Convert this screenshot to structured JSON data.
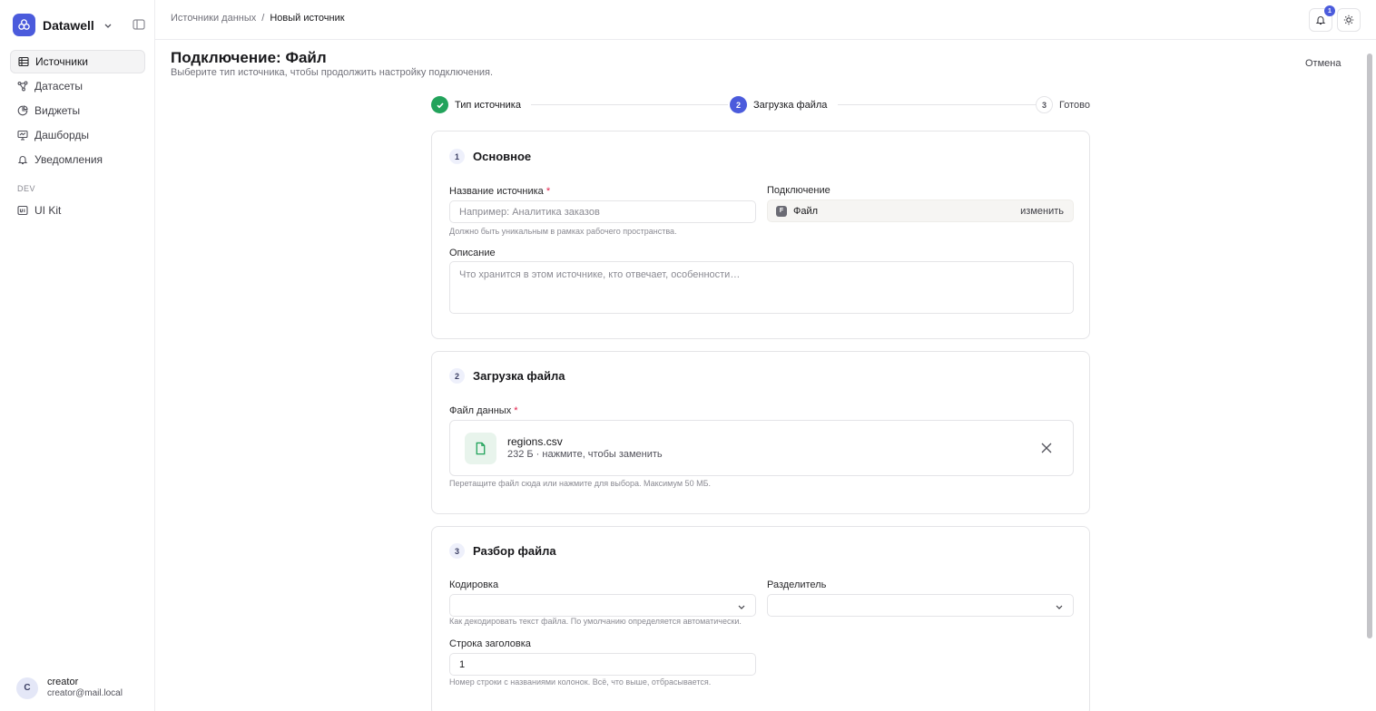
{
  "app": {
    "name": "Datawell"
  },
  "sidebar": {
    "items": [
      {
        "label": "Источники",
        "icon": "list-icon",
        "active": true
      },
      {
        "label": "Датасеты",
        "icon": "share-nodes-icon"
      },
      {
        "label": "Виджеты",
        "icon": "pie-chart-icon"
      },
      {
        "label": "Дашборды",
        "icon": "dashboard-icon"
      },
      {
        "label": "Уведомления",
        "icon": "bell-icon"
      }
    ],
    "section_dev": "DEV",
    "dev_items": [
      {
        "label": "UI Kit",
        "icon": "ui-kit-icon"
      }
    ]
  },
  "user": {
    "initial": "C",
    "name": "creator",
    "email": "creator@mail.local"
  },
  "topbar": {
    "breadcrumb_root": "Источники данных",
    "breadcrumb_sep": "/",
    "breadcrumb_current": "Новый источник",
    "notifications_count": "1"
  },
  "page": {
    "title": "Подключение: Файл",
    "subtitle": "Выберите тип источника, чтобы продолжить настройку подключения.",
    "cancel_label": "Отмена"
  },
  "stepper": [
    {
      "label": "Тип источника",
      "state": "done"
    },
    {
      "number": "2",
      "label": "Загрузка файла",
      "state": "active"
    },
    {
      "number": "3",
      "label": "Готово",
      "state": "todo"
    }
  ],
  "basic": {
    "number": "1",
    "title": "Основное",
    "name_label": "Название источника",
    "required_mark": "*",
    "name_placeholder": "Например: Аналитика заказов",
    "name_hint": "Должно быть уникальным в рамках рабочего пространства.",
    "connection_label": "Подключение",
    "connection_icon_letter": "F",
    "connection_value": "Файл",
    "connection_change": "изменить",
    "description_label": "Описание",
    "description_placeholder": "Что хранится в этом источнике, кто отвечает, особенности…"
  },
  "upload": {
    "number": "2",
    "title": "Загрузка файла",
    "file_label": "Файл данных",
    "required_mark": "*",
    "file_name": "regions.csv",
    "file_meta": "232 Б · нажмите, чтобы заменить",
    "hint": "Перетащите файл сюда или нажмите для выбора. Максимум 50 МБ."
  },
  "parse": {
    "number": "3",
    "title": "Разбор файла",
    "encoding_label": "Кодировка",
    "encoding_value": "",
    "encoding_hint": "Как декодировать текст файла. По умолчанию определяется автоматически.",
    "delimiter_label": "Разделитель",
    "delimiter_value": "",
    "header_row_label": "Строка заголовка",
    "header_row_value": "1",
    "header_row_hint": "Номер строки с названиями колонок. Всё, что выше, отбрасывается."
  },
  "colors": {
    "accent": "#4b5bdc",
    "success": "#22a35b",
    "required": "#e11d48"
  }
}
